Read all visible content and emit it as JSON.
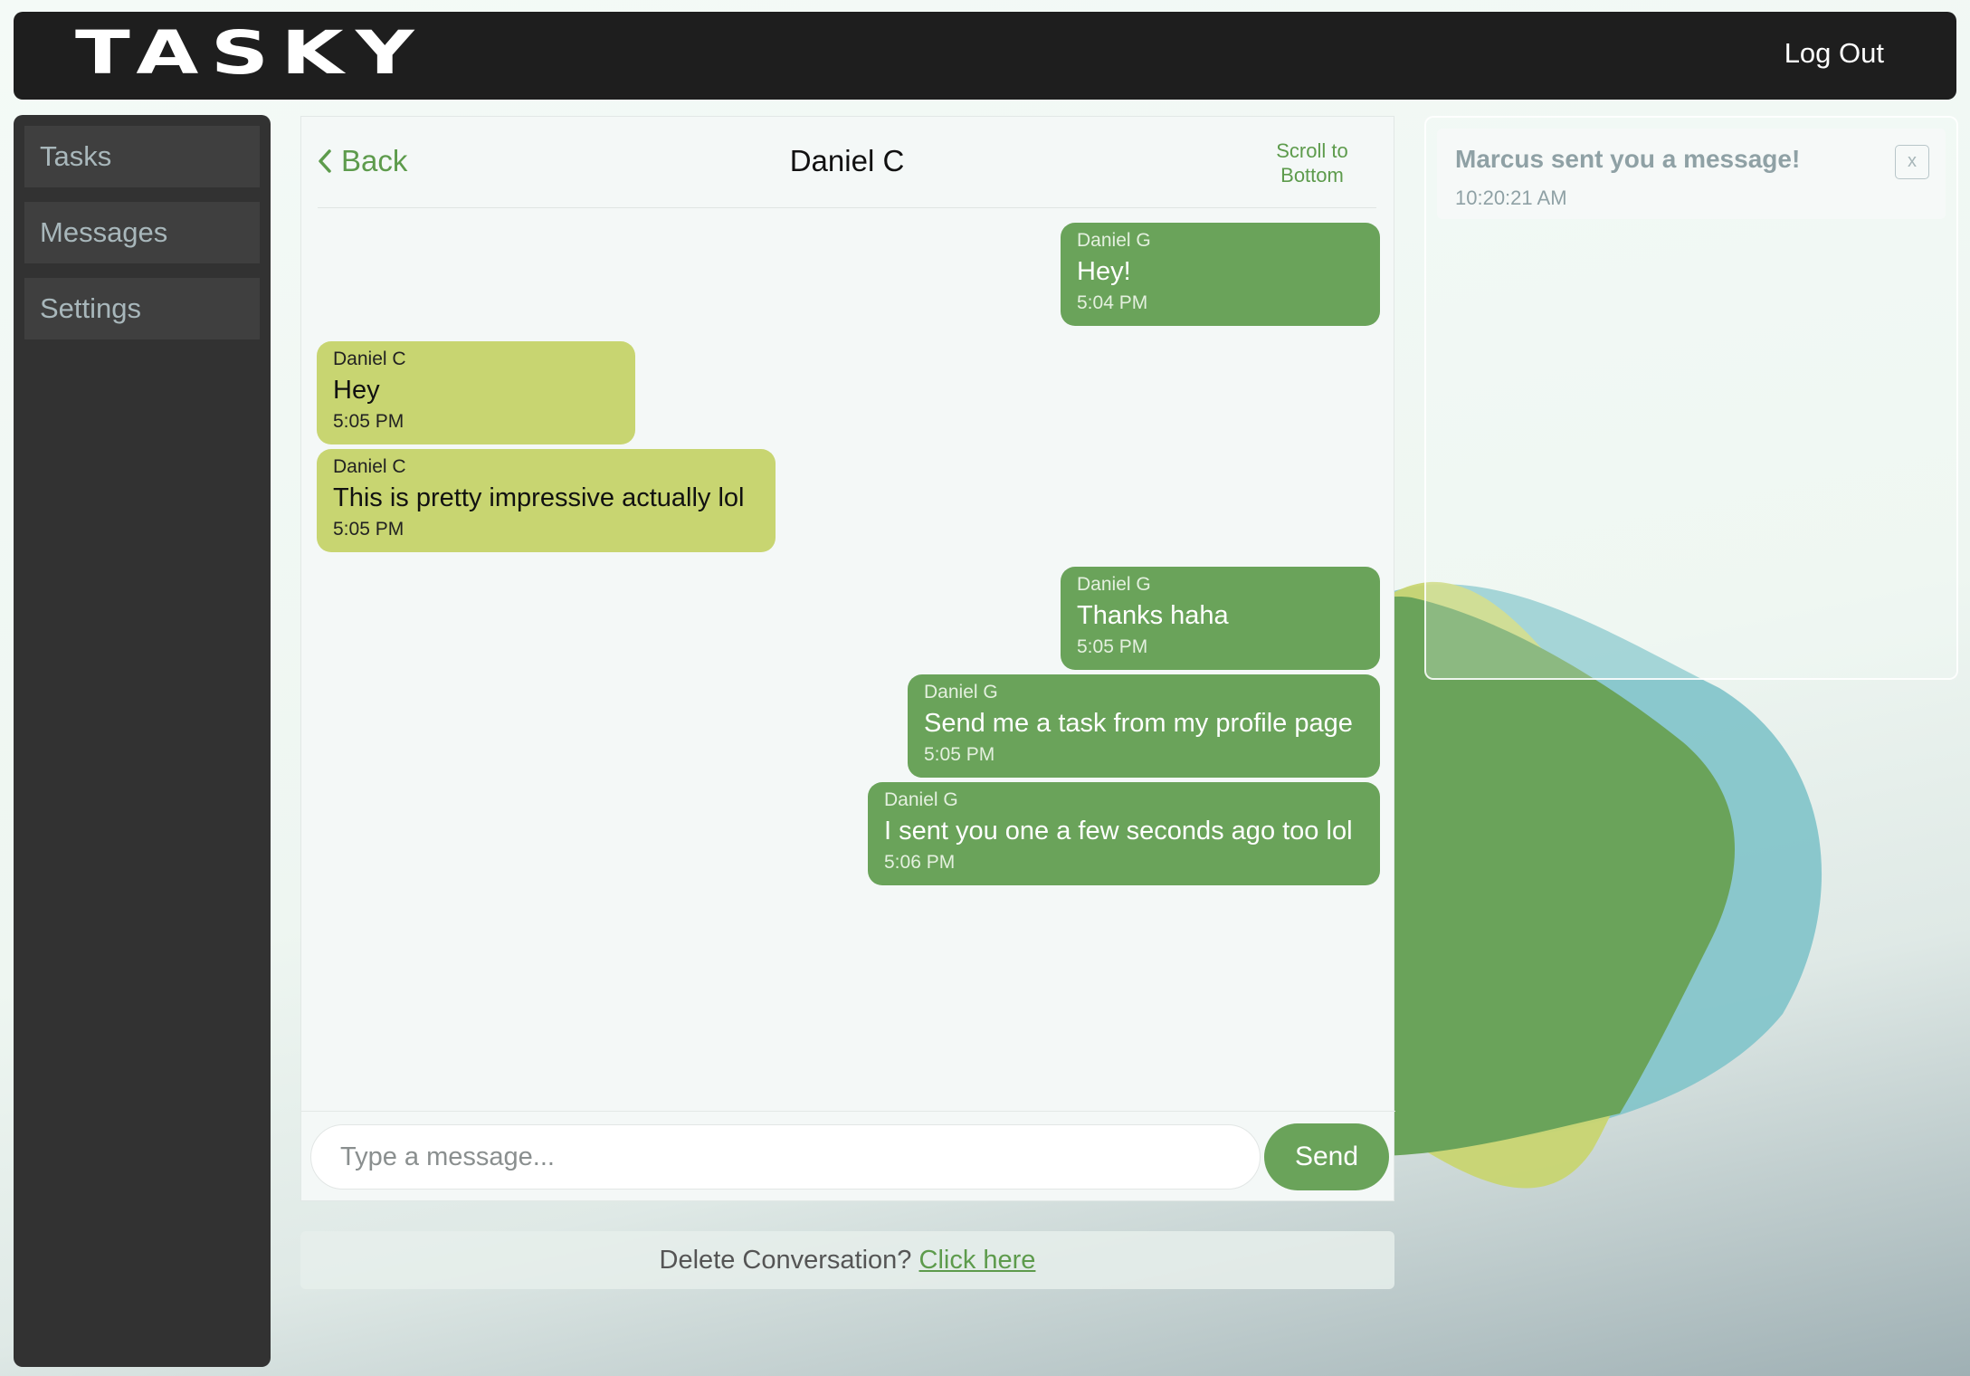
{
  "app": {
    "logo": "TASKY",
    "logout_label": "Log Out"
  },
  "sidebar": {
    "items": [
      {
        "label": "Tasks"
      },
      {
        "label": "Messages"
      },
      {
        "label": "Settings"
      }
    ]
  },
  "chat": {
    "back_label": "Back",
    "title": "Daniel C",
    "scroll_line1": "Scroll to",
    "scroll_line2": "Bottom",
    "messages": [
      {
        "sender": "Daniel G",
        "text": "Hey!",
        "time": "5:04 PM",
        "mine": true
      },
      {
        "sender": "Daniel C",
        "text": "Hey",
        "time": "5:05 PM",
        "mine": false
      },
      {
        "sender": "Daniel C",
        "text": "This is pretty impressive actually lol",
        "time": "5:05 PM",
        "mine": false
      },
      {
        "sender": "Daniel G",
        "text": "Thanks haha",
        "time": "5:05 PM",
        "mine": true
      },
      {
        "sender": "Daniel G",
        "text": "Send me a task from my profile page",
        "time": "5:05 PM",
        "mine": true
      },
      {
        "sender": "Daniel G",
        "text": "I sent you one a few seconds ago too lol",
        "time": "5:06 PM",
        "mine": true
      }
    ],
    "input_placeholder": "Type a message...",
    "send_label": "Send"
  },
  "delete": {
    "prompt": "Delete Conversation?",
    "link": "Click here"
  },
  "notification": {
    "title": "Marcus sent you a message!",
    "time": "10:20:21 AM",
    "close_label": "x"
  },
  "colors": {
    "topbar": "#1e1e1e",
    "sidebar": "#323232",
    "accent_green": "#6aa35a",
    "their_bubble": "#c8d571",
    "link_green": "#5d9b4c"
  }
}
